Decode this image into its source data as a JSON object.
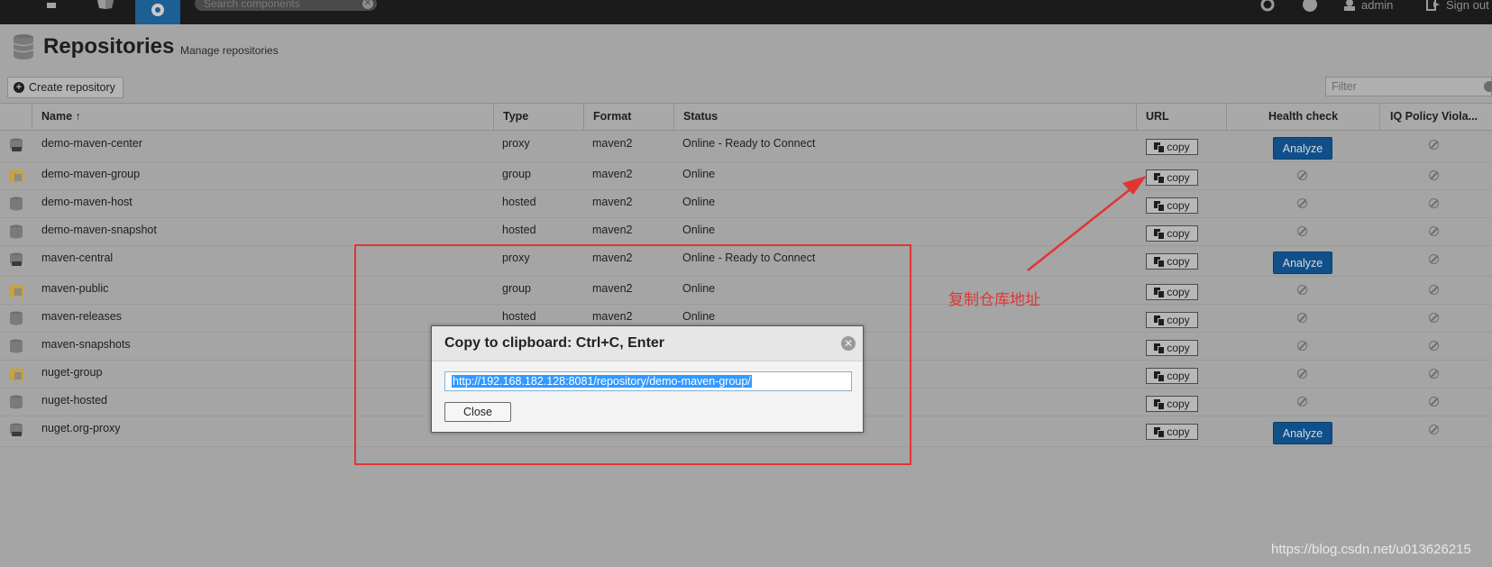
{
  "topbar": {
    "search_placeholder": "Search components",
    "clear_glyph": "✕",
    "user": "admin",
    "signout": "Sign out",
    "icons": [
      "refresh-icon",
      "help-icon",
      "user-icon",
      "signout-icon"
    ]
  },
  "header": {
    "title": "Repositories",
    "subtitle": "Manage repositories"
  },
  "toolbar": {
    "create_label": "Create repository",
    "plus_glyph": "+",
    "filter_placeholder": "Filter"
  },
  "columns": {
    "name": "Name ↑",
    "type": "Type",
    "format": "Format",
    "status": "Status",
    "url": "URL",
    "health": "Health check",
    "iq": "IQ Policy Viola..."
  },
  "rows": [
    {
      "name": "demo-maven-center",
      "type": "proxy",
      "format": "maven2",
      "status": "Online - Ready to Connect",
      "kind": "proxy",
      "analyze": true
    },
    {
      "name": "demo-maven-group",
      "type": "group",
      "format": "maven2",
      "status": "Online",
      "kind": "group",
      "analyze": false
    },
    {
      "name": "demo-maven-host",
      "type": "hosted",
      "format": "maven2",
      "status": "Online",
      "kind": "hosted",
      "analyze": false
    },
    {
      "name": "demo-maven-snapshot",
      "type": "hosted",
      "format": "maven2",
      "status": "Online",
      "kind": "hosted",
      "analyze": false
    },
    {
      "name": "maven-central",
      "type": "proxy",
      "format": "maven2",
      "status": "Online - Ready to Connect",
      "kind": "proxy",
      "analyze": true
    },
    {
      "name": "maven-public",
      "type": "group",
      "format": "maven2",
      "status": "Online",
      "kind": "group",
      "analyze": false
    },
    {
      "name": "maven-releases",
      "type": "hosted",
      "format": "maven2",
      "status": "Online",
      "kind": "hosted",
      "analyze": false
    },
    {
      "name": "maven-snapshots",
      "type": "",
      "format": "",
      "status": "",
      "kind": "hosted",
      "analyze": false
    },
    {
      "name": "nuget-group",
      "type": "",
      "format": "",
      "status": "",
      "kind": "group",
      "analyze": false
    },
    {
      "name": "nuget-hosted",
      "type": "",
      "format": "",
      "status": "",
      "kind": "hosted",
      "analyze": false
    },
    {
      "name": "nuget.org-proxy",
      "type": "",
      "format": "",
      "status": "",
      "kind": "proxy",
      "analyze": true
    }
  ],
  "copy_label": "copy",
  "analyze_label": "Analyze",
  "modal": {
    "title": "Copy to clipboard: Ctrl+C, Enter",
    "close_glyph": "✕",
    "url": "http://192.168.182.128:8081/repository/demo-maven-group/",
    "close_label": "Close"
  },
  "annotation": {
    "text": "复制仓库地址",
    "color": "#e03535"
  },
  "watermark": "https://blog.csdn.net/u013626215",
  "colors": {
    "topbar": "#1b1b1b",
    "accent": "#1c5f93",
    "analyze": "#10508a",
    "overlay_bg": "#a5a5a5"
  }
}
